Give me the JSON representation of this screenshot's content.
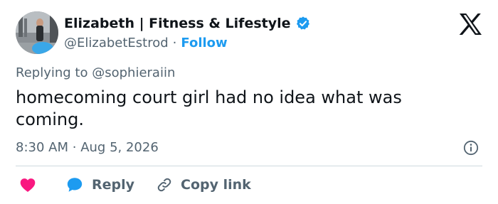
{
  "author": {
    "display_name": "Elizabeth | Fitness & Lifestyle",
    "handle": "@ElizabetEstrod",
    "separator": "·",
    "follow_label": "Follow"
  },
  "tweet": {
    "replying_prefix": "Replying to",
    "replying_to": "@sophieraiin",
    "text": "homecoming court girl had no idea what was coming.",
    "time": "8:30 AM",
    "date_separator": "·",
    "date": "Aug 5, 2026"
  },
  "actions": {
    "reply_label": "Reply",
    "copy_link_label": "Copy link"
  },
  "icons": {
    "logo": "x-logo-icon",
    "verified": "verified-badge-icon",
    "info": "info-icon",
    "like": "heart-icon",
    "reply": "speech-bubble-icon",
    "copy": "link-icon"
  },
  "colors": {
    "accent": "#1d9bf0",
    "like": "#f91880",
    "text_primary": "#0f1419",
    "text_secondary": "#536471",
    "divider": "#cfd9de"
  }
}
